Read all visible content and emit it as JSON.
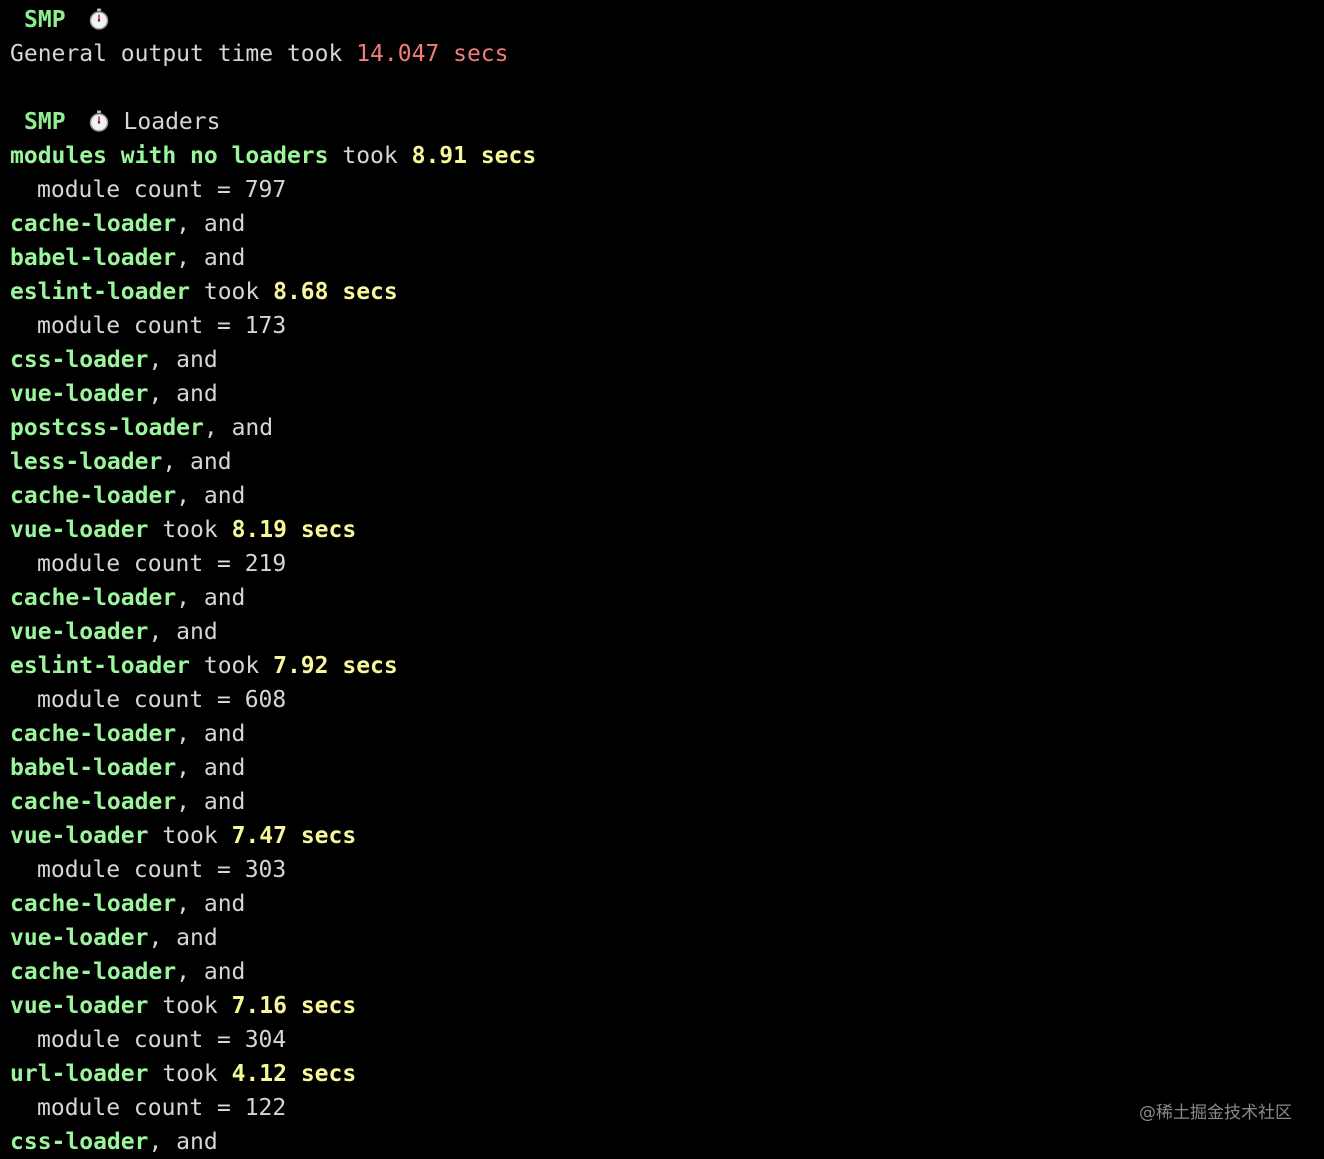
{
  "smp_tag": "SMP",
  "icons": {
    "timer": "stopwatch-icon"
  },
  "colors": {
    "background": "#000000",
    "loader_name": "#9cf59c",
    "time": "#f7f79a",
    "general_time": "#f07c7c",
    "plain": "#d6d6d6"
  },
  "general": {
    "prefix": "General output time took ",
    "time": "14.047 secs"
  },
  "loaders_section": {
    "title": "Loaders"
  },
  "lines": [
    {
      "kind": "took",
      "name": "modules with no loaders",
      "mid": " took ",
      "time": "8.91 secs"
    },
    {
      "kind": "count",
      "text": "module count = 797"
    },
    {
      "kind": "and",
      "name": "cache-loader",
      "suffix": ", and"
    },
    {
      "kind": "and",
      "name": "babel-loader",
      "suffix": ", and"
    },
    {
      "kind": "took",
      "name": "eslint-loader",
      "mid": " took ",
      "time": "8.68 secs"
    },
    {
      "kind": "count",
      "text": "module count = 173"
    },
    {
      "kind": "and",
      "name": "css-loader",
      "suffix": ", and"
    },
    {
      "kind": "and",
      "name": "vue-loader",
      "suffix": ", and"
    },
    {
      "kind": "and",
      "name": "postcss-loader",
      "suffix": ", and"
    },
    {
      "kind": "and",
      "name": "less-loader",
      "suffix": ", and"
    },
    {
      "kind": "and",
      "name": "cache-loader",
      "suffix": ", and"
    },
    {
      "kind": "took",
      "name": "vue-loader",
      "mid": " took ",
      "time": "8.19 secs"
    },
    {
      "kind": "count",
      "text": "module count = 219"
    },
    {
      "kind": "and",
      "name": "cache-loader",
      "suffix": ", and"
    },
    {
      "kind": "and",
      "name": "vue-loader",
      "suffix": ", and"
    },
    {
      "kind": "took",
      "name": "eslint-loader",
      "mid": " took ",
      "time": "7.92 secs"
    },
    {
      "kind": "count",
      "text": "module count = 608"
    },
    {
      "kind": "and",
      "name": "cache-loader",
      "suffix": ", and"
    },
    {
      "kind": "and",
      "name": "babel-loader",
      "suffix": ", and"
    },
    {
      "kind": "and",
      "name": "cache-loader",
      "suffix": ", and"
    },
    {
      "kind": "took",
      "name": "vue-loader",
      "mid": " took ",
      "time": "7.47 secs"
    },
    {
      "kind": "count",
      "text": "module count = 303"
    },
    {
      "kind": "and",
      "name": "cache-loader",
      "suffix": ", and"
    },
    {
      "kind": "and",
      "name": "vue-loader",
      "suffix": ", and"
    },
    {
      "kind": "and",
      "name": "cache-loader",
      "suffix": ", and"
    },
    {
      "kind": "took",
      "name": "vue-loader",
      "mid": " took ",
      "time": "7.16 secs"
    },
    {
      "kind": "count",
      "text": "module count = 304"
    },
    {
      "kind": "took",
      "name": "url-loader",
      "mid": " took ",
      "time": "4.12 secs"
    },
    {
      "kind": "count",
      "text": "module count = 122"
    },
    {
      "kind": "and",
      "name": "css-loader",
      "suffix": ", and"
    }
  ],
  "watermark": "@稀土掘金技术社区"
}
